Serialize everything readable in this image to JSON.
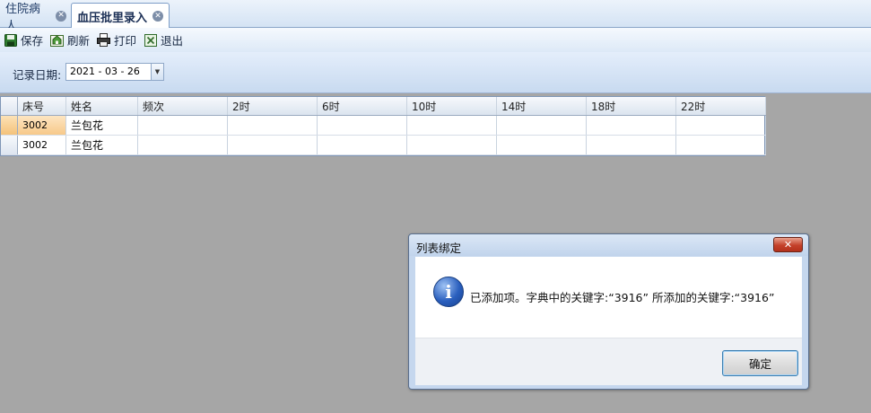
{
  "tabs": [
    {
      "label": "住院病人"
    },
    {
      "label": "血压批里录入"
    }
  ],
  "toolbar": {
    "save": "保存",
    "refresh": "刷新",
    "print": "打印",
    "exit": "退出"
  },
  "filter": {
    "date_label": "记录日期:",
    "date_value": "2021 - 03 - 26"
  },
  "grid": {
    "columns": [
      "床号",
      "姓名",
      "频次",
      "2时",
      "6时",
      "10时",
      "14时",
      "18时",
      "22时"
    ],
    "rows": [
      [
        "3002",
        "兰包花",
        "",
        "",
        "",
        "",
        "",
        "",
        ""
      ],
      [
        "3002",
        "兰包花",
        "",
        "",
        "",
        "",
        "",
        "",
        ""
      ]
    ]
  },
  "dialog": {
    "title": "列表绑定",
    "message": "已添加项。字典中的关键字:“3916” 所添加的关键字:“3916”",
    "ok_label": "确定",
    "close_glyph": "✕",
    "info_glyph": "i"
  },
  "colors": {
    "workspace_bg": "#a6a6a6",
    "selected_cell": "#f7c98a",
    "close_button_red": "#c4412a"
  }
}
